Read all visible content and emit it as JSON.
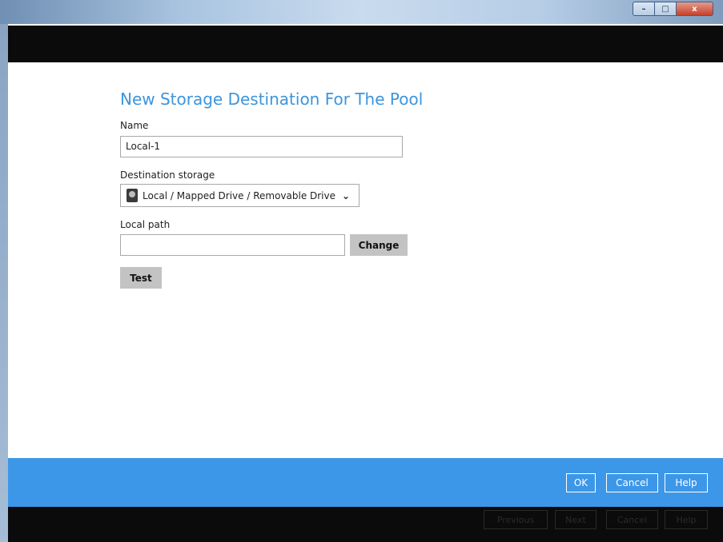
{
  "window": {
    "minimize_glyph": "–",
    "maximize_glyph": "□",
    "close_glyph": "x"
  },
  "page": {
    "title": "New Storage Destination For The Pool"
  },
  "form": {
    "name_label": "Name",
    "name_value": "Local-1",
    "destination_label": "Destination storage",
    "destination_value": "Local / Mapped Drive / Removable Drive",
    "destination_icon": "hard-drive-icon",
    "local_path_label": "Local path",
    "local_path_value": "",
    "change_label": "Change",
    "test_label": "Test"
  },
  "dialog_footer": {
    "ok_label": "OK",
    "cancel_label": "Cancel",
    "help_label": "Help"
  },
  "wizard_footer": {
    "previous_label": "Previous",
    "next_label": "Next",
    "cancel_label": "Cancel",
    "help_label": "Help"
  },
  "colors": {
    "title": "#3c95dd",
    "footer_blue": "#3d97e8",
    "button_gray": "#c3c3c3",
    "header_band": "#0b0b0b"
  }
}
